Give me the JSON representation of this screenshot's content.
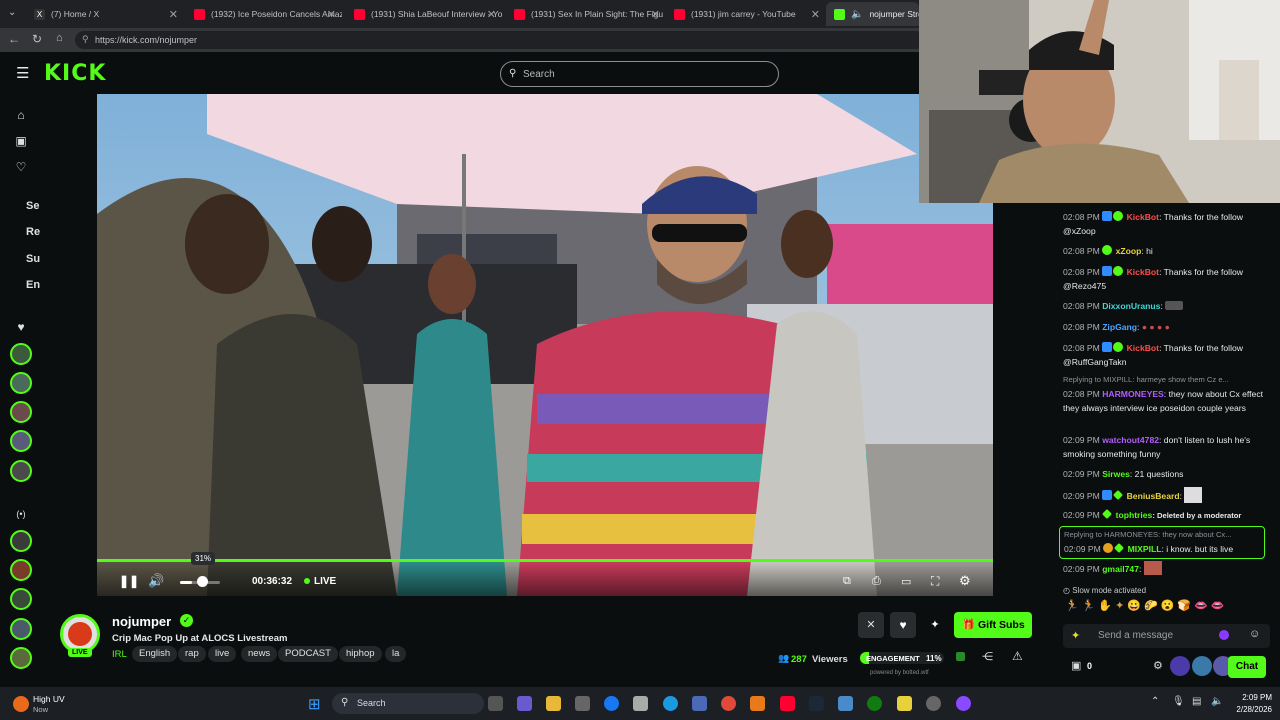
{
  "browser": {
    "tabs": [
      {
        "title": "(7) Home / X"
      },
      {
        "title": "(1932) Ice Poseidon Cancels Amaz"
      },
      {
        "title": "(1931) Shia LaBeouf Interview - Yo"
      },
      {
        "title": "(1931) Sex In Plain Sight: The Figu"
      },
      {
        "title": "(1931) jim carrey - YouTube"
      },
      {
        "title": "nojumper Stream"
      }
    ],
    "url": "https://kick.com/nojumper"
  },
  "kick": {
    "logo": "KICK",
    "search_placeholder": "Search",
    "rail_labels": [
      "Se",
      "Re",
      "Su",
      "En"
    ]
  },
  "player": {
    "volume_percent": 31,
    "volume_tooltip": "31%",
    "time": "00:36:32",
    "live_label": "LIVE"
  },
  "channel": {
    "name": "nojumper",
    "live_badge": "LIVE",
    "title": "Crip Mac Pop Up at ALOCS Livestream",
    "category": "IRL",
    "tags": [
      "English",
      "rap",
      "live",
      "news",
      "PODCAST",
      "hiphop",
      "la"
    ],
    "viewers": "287",
    "viewers_label": "Viewers",
    "engagement_label": "ENGAGEMENT",
    "engagement_value": "11%",
    "powered_by": "powered by botted.wtf",
    "gift_subs_label": "Gift Subs"
  },
  "chat": {
    "messages": [
      {
        "time": "02:08 PM",
        "user": "KickBot",
        "text": ": Thanks for the follow @xZoop"
      },
      {
        "time": "02:08 PM",
        "user": "xZoop",
        "text": ": hi"
      },
      {
        "time": "02:08 PM",
        "user": "KickBot",
        "text": ": Thanks for the follow @Rezo475"
      },
      {
        "time": "02:08 PM",
        "user": "DixxonUranus",
        "text": ":"
      },
      {
        "time": "02:08 PM",
        "user": "ZipGang",
        "text": ":"
      },
      {
        "time": "02:08 PM",
        "user": "KickBot",
        "text": ": Thanks for the follow @RuffGangTakn"
      },
      {
        "reply": "Replying to MIXPILL: harmeye show them Cz e...",
        "time": "02:08 PM",
        "user": "HARMONEYES",
        "text": ": they now about Cx effect they always interview ice poseidon couple years"
      },
      {
        "time": "02:09 PM",
        "user": "watchout4782",
        "text": ": don't listen to lush he's smoking something funny"
      },
      {
        "time": "02:09 PM",
        "user": "Sirwes",
        "text": ": 21 questions"
      },
      {
        "time": "02:09 PM",
        "user": "BeniusBeard",
        "text": ":"
      },
      {
        "time": "02:09 PM",
        "user": "tophtries",
        "text": ": Deleted by a moderator"
      },
      {
        "reply": "Replying to HARMONEYES: they now about Cx...",
        "time": "02:09 PM",
        "user": "MIXPILL",
        "text": ": i know. but its live"
      },
      {
        "time": "02:09 PM",
        "user": "gmail747",
        "text": ":"
      }
    ],
    "slow_mode": "Slow mode activated",
    "input_placeholder": "Send a message",
    "points": "0",
    "chat_button": "Chat"
  },
  "taskbar": {
    "weather_title": "High UV",
    "weather_sub": "Now",
    "search_label": "Search",
    "clock_time": "2:09 PM",
    "clock_date": "2/28/2026"
  }
}
